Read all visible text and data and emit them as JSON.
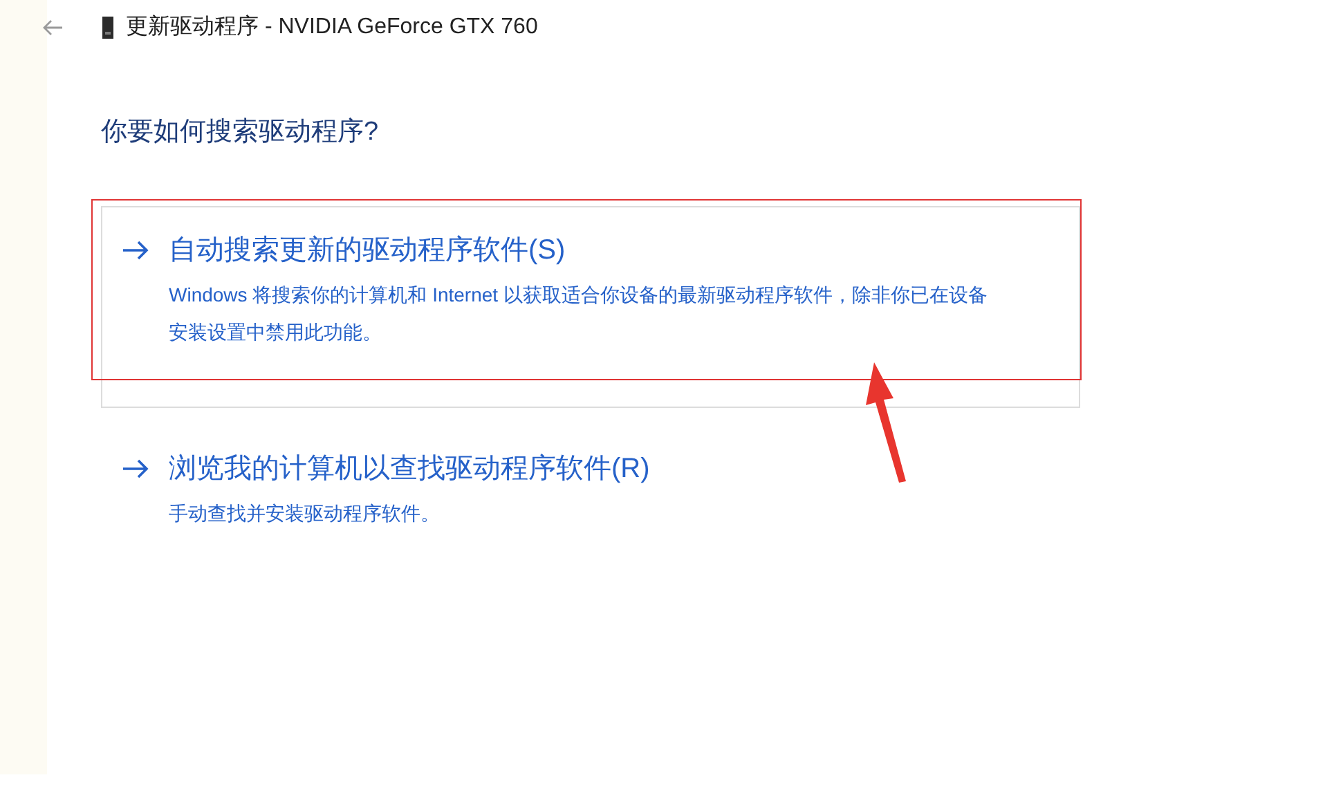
{
  "window": {
    "title": "更新驱动程序 - NVIDIA GeForce GTX 760"
  },
  "heading": "你要如何搜索驱动程序?",
  "options": [
    {
      "title": "自动搜索更新的驱动程序软件(S)",
      "description": "Windows 将搜索你的计算机和 Internet 以获取适合你设备的最新驱动程序软件，除非你已在设备安装设置中禁用此功能。",
      "selected": true,
      "highlighted": true
    },
    {
      "title": "浏览我的计算机以查找驱动程序软件(R)",
      "description": "手动查找并安装驱动程序软件。",
      "selected": false,
      "highlighted": false
    }
  ]
}
